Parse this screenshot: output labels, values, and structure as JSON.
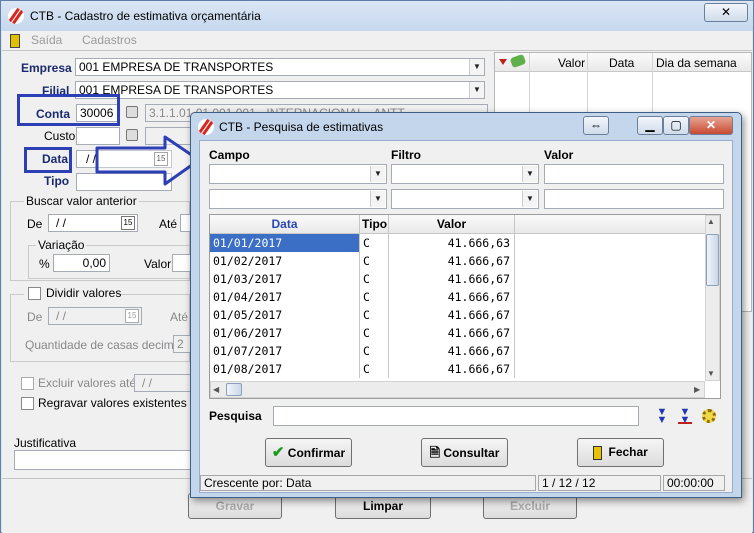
{
  "main": {
    "title": "CTB - Cadastro de estimativa orçamentária",
    "menu": [
      "Saída",
      "Cadastros"
    ],
    "form": {
      "empresa_label": "Empresa",
      "empresa_value": "001 EMPRESA DE TRANSPORTES",
      "filial_label": "Filial",
      "filial_value": "001 EMPRESA DE TRANSPORTES",
      "conta_label": "Conta",
      "conta_value": "30006",
      "conta_desc": "3.1.1.01.01.001.001 - INTERNACIONAL - ANTT",
      "custo_label": "Custo",
      "data_label": "Data",
      "data_value": "/ /",
      "tipo_label": "Tipo"
    },
    "buscar": {
      "title": "Buscar valor anterior",
      "de_label": "De",
      "de_value": "/ /",
      "ate_label": "Até",
      "variacao_label": "Variação",
      "pct_label": "%",
      "pct_value": "0,00",
      "valor_label": "Valor"
    },
    "dividir": {
      "label": "Dividir valores",
      "de_label": "De",
      "de_value": "/ /",
      "ate_label": "Até",
      "casas_label": "Quantidade de casas decimais",
      "casas_value": "2"
    },
    "excluir_label": "Excluir valores até",
    "excluir_value": "/ /",
    "regravar_label": "Regravar valores existentes",
    "justificativa_label": "Justificativa",
    "right_grid_headers": [
      "Valor",
      "Data",
      "Dia da semana"
    ],
    "buttons": {
      "gravar": "Gravar",
      "limpar": "Limpar",
      "excluir": "Excluir"
    }
  },
  "dialog": {
    "title": "CTB - Pesquisa de estimativas",
    "campo_label": "Campo",
    "filtro_label": "Filtro",
    "valor_label": "Valor",
    "columns": [
      "Data",
      "Tipo",
      "Valor"
    ],
    "rows": [
      {
        "data": "01/01/2017",
        "tipo": "C",
        "valor": "41.666,63"
      },
      {
        "data": "01/02/2017",
        "tipo": "C",
        "valor": "41.666,67"
      },
      {
        "data": "01/03/2017",
        "tipo": "C",
        "valor": "41.666,67"
      },
      {
        "data": "01/04/2017",
        "tipo": "C",
        "valor": "41.666,67"
      },
      {
        "data": "01/05/2017",
        "tipo": "C",
        "valor": "41.666,67"
      },
      {
        "data": "01/06/2017",
        "tipo": "C",
        "valor": "41.666,67"
      },
      {
        "data": "01/07/2017",
        "tipo": "C",
        "valor": "41.666,67"
      },
      {
        "data": "01/08/2017",
        "tipo": "C",
        "valor": "41.666,67"
      }
    ],
    "pesquisa_label": "Pesquisa",
    "buttons": {
      "confirmar": "Confirmar",
      "consultar": "Consultar",
      "fechar": "Fechar"
    },
    "status": {
      "order": "Crescente por: Data",
      "record": "1 / 12 / 12",
      "time": "00:00:00"
    }
  },
  "colors": {
    "highlight": "#2d3fb4",
    "selection": "#3b6fc6",
    "label_blue": "#1a2a6e"
  }
}
